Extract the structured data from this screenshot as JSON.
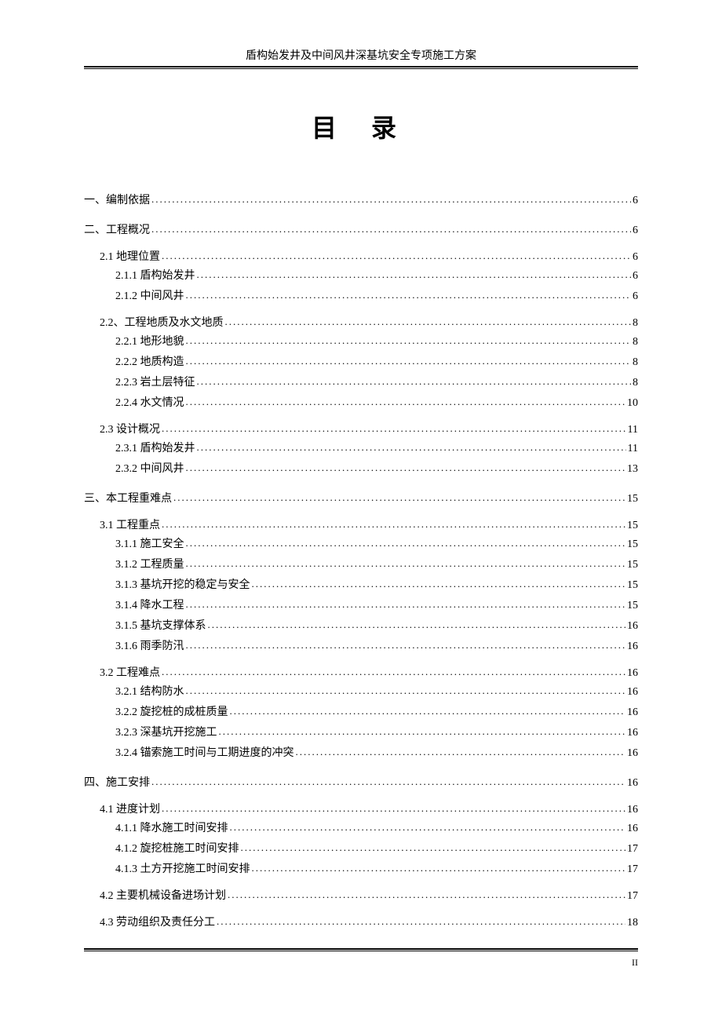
{
  "header": "盾构始发井及中间风井深基坑安全专项施工方案",
  "title": "目 录",
  "toc": [
    {
      "level": 1,
      "text": "一、编制依据",
      "page": "6"
    },
    {
      "level": 1,
      "text": "二、工程概况",
      "page": "6"
    },
    {
      "level": 2,
      "text": "2.1 地理位置",
      "page": "6"
    },
    {
      "level": 3,
      "text": "2.1.1 盾构始发井",
      "page": "6"
    },
    {
      "level": 3,
      "text": "2.1.2 中间风井",
      "page": "6"
    },
    {
      "level": 2,
      "text": "2.2、工程地质及水文地质",
      "page": "8"
    },
    {
      "level": 3,
      "text": "2.2.1 地形地貌",
      "page": "8"
    },
    {
      "level": 3,
      "text": "2.2.2 地质构造",
      "page": "8"
    },
    {
      "level": 3,
      "text": "2.2.3 岩土层特征",
      "page": "8"
    },
    {
      "level": 3,
      "text": "2.2.4 水文情况",
      "page": "10"
    },
    {
      "level": 2,
      "text": "2.3 设计概况",
      "page": "11"
    },
    {
      "level": 3,
      "text": "2.3.1 盾构始发井",
      "page": "11"
    },
    {
      "level": 3,
      "text": "2.3.2 中间风井",
      "page": "13"
    },
    {
      "level": 1,
      "text": "三、本工程重难点",
      "page": "15"
    },
    {
      "level": 2,
      "text": "3.1 工程重点",
      "page": "15"
    },
    {
      "level": 3,
      "text": "3.1.1 施工安全",
      "page": "15"
    },
    {
      "level": 3,
      "text": "3.1.2 工程质量",
      "page": "15"
    },
    {
      "level": 3,
      "text": "3.1.3 基坑开挖的稳定与安全",
      "page": "15"
    },
    {
      "level": 3,
      "text": "3.1.4 降水工程",
      "page": "15"
    },
    {
      "level": 3,
      "text": "3.1.5 基坑支撑体系",
      "page": "16"
    },
    {
      "level": 3,
      "text": "3.1.6 雨季防汛",
      "page": "16"
    },
    {
      "level": 2,
      "text": "3.2 工程难点",
      "page": "16"
    },
    {
      "level": 3,
      "text": "3.2.1 结构防水",
      "page": "16"
    },
    {
      "level": 3,
      "text": "3.2.2 旋挖桩的成桩质量",
      "page": "16"
    },
    {
      "level": 3,
      "text": "3.2.3 深基坑开挖施工",
      "page": "16"
    },
    {
      "level": 3,
      "text": "3.2.4 锚索施工时间与工期进度的冲突",
      "page": "16"
    },
    {
      "level": 1,
      "text": "四、施工安排",
      "page": "16"
    },
    {
      "level": 2,
      "text": "4.1 进度计划",
      "page": "16"
    },
    {
      "level": 3,
      "text": "4.1.1 降水施工时间安排",
      "page": "16"
    },
    {
      "level": 3,
      "text": "4.1.2 旋挖桩施工时间安排",
      "page": "17"
    },
    {
      "level": 3,
      "text": "4.1.3 土方开挖施工时间安排",
      "page": "17"
    },
    {
      "level": 2,
      "text": "4.2 主要机械设备进场计划",
      "page": "17"
    },
    {
      "level": 2,
      "text": "4.3 劳动组织及责任分工",
      "page": "18"
    }
  ],
  "page_number": "II"
}
